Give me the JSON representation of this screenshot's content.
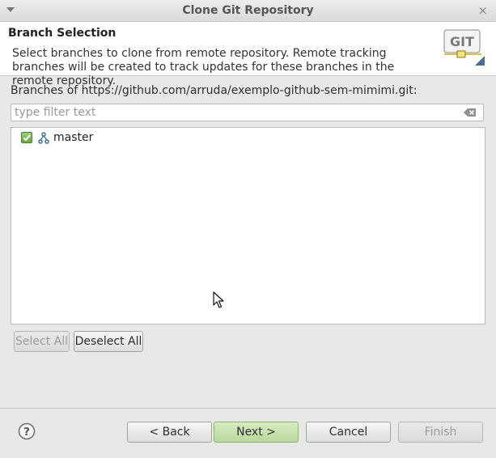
{
  "window": {
    "title": "Clone Git Repository",
    "close_glyph": "×"
  },
  "header": {
    "title": "Branch Selection",
    "description": "Select branches to clone from remote repository. Remote tracking branches will be created to track updates for these branches in the remote repository.",
    "logo_text": "GIT"
  },
  "main": {
    "repo_label": "Branches of https://github.com/arruda/exemplo-github-sem-mimimi.git:",
    "filter": {
      "placeholder": "type filter text",
      "value": ""
    },
    "branches": [
      {
        "label": "master",
        "checked": true,
        "icon": "branch-icon"
      }
    ],
    "select_all_label": "Select All",
    "deselect_all_label": "Deselect All"
  },
  "footer": {
    "back_label": "< Back",
    "next_label": "Next >",
    "cancel_label": "Cancel",
    "finish_label": "Finish"
  },
  "colors": {
    "checkbox": "#6aa544",
    "default_button": "#b9d99b",
    "git_logo_accent": "#d8c24a"
  }
}
